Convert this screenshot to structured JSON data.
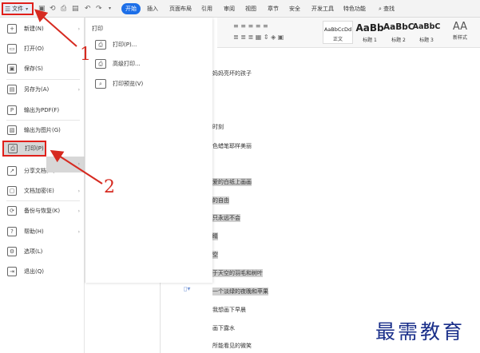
{
  "menubar": {
    "file_label": "文件",
    "tabs": [
      "开始",
      "插入",
      "页面布局",
      "引用",
      "审阅",
      "视图",
      "章节",
      "安全",
      "开发工具",
      "特色功能"
    ],
    "search_label": "查找"
  },
  "ribbon": {
    "styles": [
      {
        "sample": "AaBbCcDd",
        "name": "正文"
      },
      {
        "sample": "AaBb",
        "name": "标题 1"
      },
      {
        "sample": "AaBbC",
        "name": "标题 2"
      },
      {
        "sample": "AaBbC",
        "name": "标题 3"
      }
    ],
    "new_style_glyph": "AA",
    "new_style_label": "新样式"
  },
  "file_menu": {
    "items": [
      {
        "label": "新建(N)",
        "icon": "new-doc-icon",
        "arrow": true
      },
      {
        "label": "打开(O)",
        "icon": "folder-icon",
        "arrow": false
      },
      {
        "label": "保存(S)",
        "icon": "save-icon",
        "arrow": false
      },
      {
        "label": "另存为(A)",
        "icon": "save-as-icon",
        "arrow": true
      },
      {
        "label": "输出为PDF(F)",
        "icon": "pdf-icon",
        "arrow": false
      },
      {
        "label": "输出为图片(G)",
        "icon": "image-icon",
        "arrow": false
      },
      {
        "label": "打印(P)",
        "icon": "printer-icon",
        "arrow": true
      },
      {
        "label": "分享文档(D)",
        "icon": "share-icon",
        "arrow": false
      },
      {
        "label": "文档加密(E)",
        "icon": "encrypt-icon",
        "arrow": true
      },
      {
        "label": "备份与恢复(K)",
        "icon": "backup-icon",
        "arrow": true
      },
      {
        "label": "帮助(H)",
        "icon": "help-icon",
        "arrow": true
      },
      {
        "label": "选项(L)",
        "icon": "options-icon",
        "arrow": false
      },
      {
        "label": "退出(Q)",
        "icon": "exit-icon",
        "arrow": false
      }
    ]
  },
  "print_panel": {
    "title": "打印",
    "items": [
      {
        "label": "打印(P)...",
        "icon": "printer-icon"
      },
      {
        "label": "高级打印...",
        "icon": "advanced-print-icon"
      },
      {
        "label": "打印预览(V)",
        "icon": "print-preview-icon"
      }
    ]
  },
  "document": {
    "lines": [
      {
        "text": "妈妈亮坏的孩子",
        "highlight": false
      },
      {
        "text": "",
        "highlight": false
      },
      {
        "text": "时刻",
        "highlight": false
      },
      {
        "text": "色蜡笔耶样美丽",
        "highlight": false
      },
      {
        "text": "",
        "highlight": true
      },
      {
        "text": "爱的白纸上画画",
        "highlight": true
      },
      {
        "text": "的自由",
        "highlight": true
      },
      {
        "text": "只永远不会",
        "highlight": true
      },
      {
        "text": "睛",
        "highlight": true
      },
      {
        "text": "空",
        "highlight": true
      },
      {
        "text": "于天空的羽毛和树叶",
        "highlight": true
      },
      {
        "text": "一个淡绿的夜晚和苹果",
        "highlight": true
      },
      {
        "text": "我想画下早晨",
        "highlight": false
      },
      {
        "text": "画下露水",
        "highlight": false
      },
      {
        "text": "所能看见的微笑",
        "highlight": false
      }
    ]
  },
  "annotations": {
    "step1": "1",
    "step2": "2",
    "watermark": "最需教育",
    "color": "#d62a20"
  }
}
